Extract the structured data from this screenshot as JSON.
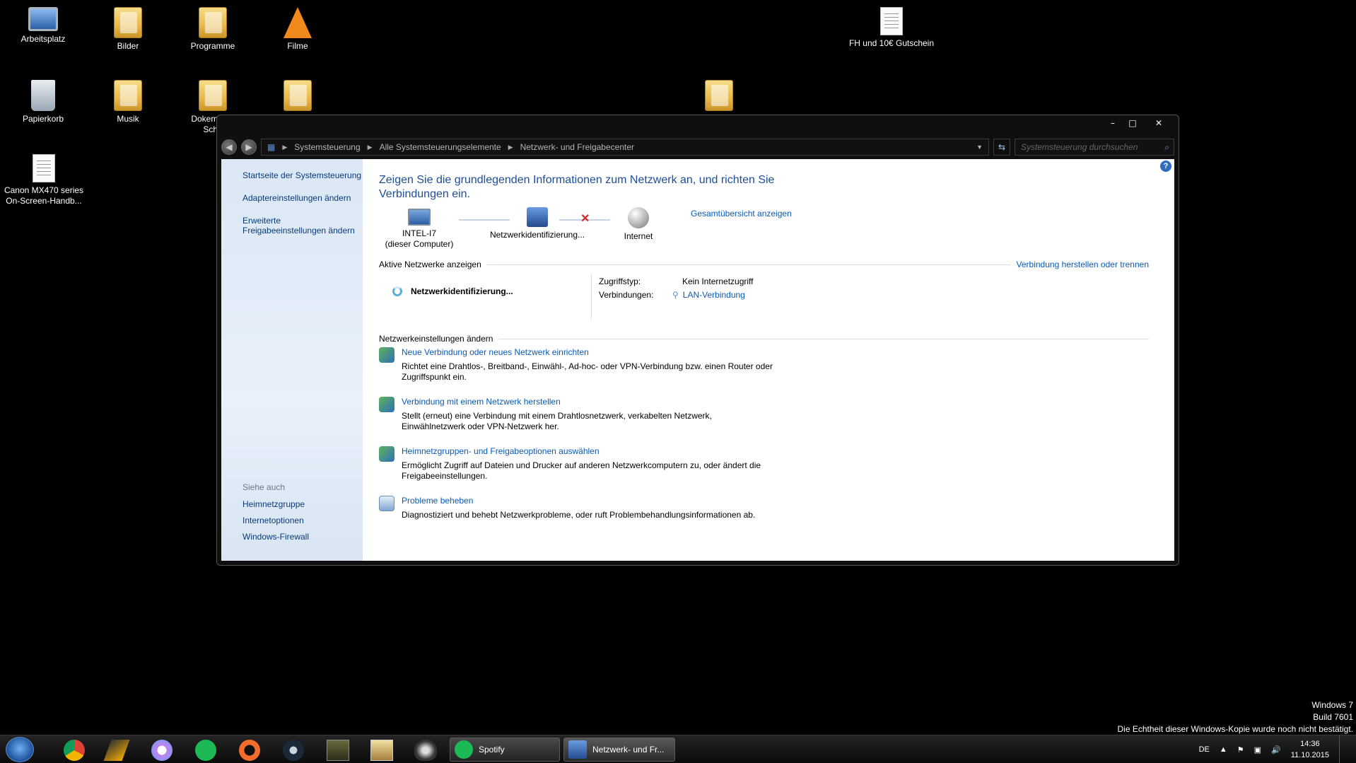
{
  "desktop": {
    "icons": [
      {
        "label": "Arbeitsplatz"
      },
      {
        "label": "Bilder"
      },
      {
        "label": "Programme"
      },
      {
        "label": "Filme"
      },
      {
        "label": "FH und 10€ Gutschein"
      },
      {
        "label": "Papierkorb"
      },
      {
        "label": "Musik"
      },
      {
        "label": "Dokemente Schu"
      },
      {
        "label": "Canon MX470 series On-Screen-Handb..."
      }
    ]
  },
  "window": {
    "controls": {
      "minimize": "–",
      "maximize": "□",
      "close": "✕"
    },
    "breadcrumb": [
      "Systemsteuerung",
      "Alle Systemsteuerungselemente",
      "Netzwerk- und Freigabecenter"
    ],
    "search_placeholder": "Systemsteuerung durchsuchen",
    "left": {
      "links": [
        "Startseite der Systemsteuerung",
        "Adaptereinstellungen ändern",
        "Erweiterte Freigabeeinstellungen ändern"
      ],
      "see_also_label": "Siehe auch",
      "see_also": [
        "Heimnetzgruppe",
        "Internetoptionen",
        "Windows-Firewall"
      ]
    },
    "main": {
      "heading": "Zeigen Sie die grundlegenden Informationen zum Netzwerk an, und richten Sie Verbindungen ein.",
      "map": {
        "computer_name": "INTEL-I7",
        "computer_sub": "(dieser Computer)",
        "network": "Netzwerkidentifizierung...",
        "internet": "Internet",
        "full_map_link": "Gesamtübersicht anzeigen"
      },
      "active_networks": {
        "label": "Aktive Netzwerke anzeigen",
        "connect_link": "Verbindung herstellen oder trennen",
        "network_name": "Netzwerkidentifizierung...",
        "access_type_label": "Zugriffstyp:",
        "access_type_value": "Kein Internetzugriff",
        "connections_label": "Verbindungen:",
        "connections_value": "LAN-Verbindung"
      },
      "change_settings": {
        "label": "Netzwerkeinstellungen ändern",
        "tasks": [
          {
            "title": "Neue Verbindung oder neues Netzwerk einrichten",
            "desc": "Richtet eine Drahtlos-, Breitband-, Einwähl-, Ad-hoc- oder VPN-Verbindung bzw. einen Router oder Zugriffspunkt ein."
          },
          {
            "title": "Verbindung mit einem Netzwerk herstellen",
            "desc": "Stellt (erneut) eine Verbindung mit einem Drahtlosnetzwerk, verkabelten Netzwerk, Einwählnetzwerk oder VPN-Netzwerk her."
          },
          {
            "title": "Heimnetzgruppen- und Freigabeoptionen auswählen",
            "desc": "Ermöglicht Zugriff auf Dateien und Drucker auf anderen Netzwerkcomputern zu, oder ändert die Freigabeeinstellungen."
          },
          {
            "title": "Probleme beheben",
            "desc": "Diagnostiziert und behebt Netzwerkprobleme, oder ruft Problembehandlungsinformationen ab."
          }
        ]
      }
    }
  },
  "watermark": {
    "line1": "Windows 7",
    "line2": "Build 7601",
    "line3": "Die Echtheit dieser Windows-Kopie wurde noch nicht bestätigt."
  },
  "taskbar": {
    "tasks": [
      {
        "label": "Spotify"
      },
      {
        "label": "Netzwerk- und Fr..."
      }
    ],
    "tray": {
      "language": "DE",
      "time": "14:36",
      "date": "11.10.2015"
    }
  },
  "colors": {
    "link": "#0a5ab4",
    "heading": "#1e4d9a",
    "leftpane": "#dbe7f5",
    "error_x": "#d8262b"
  }
}
